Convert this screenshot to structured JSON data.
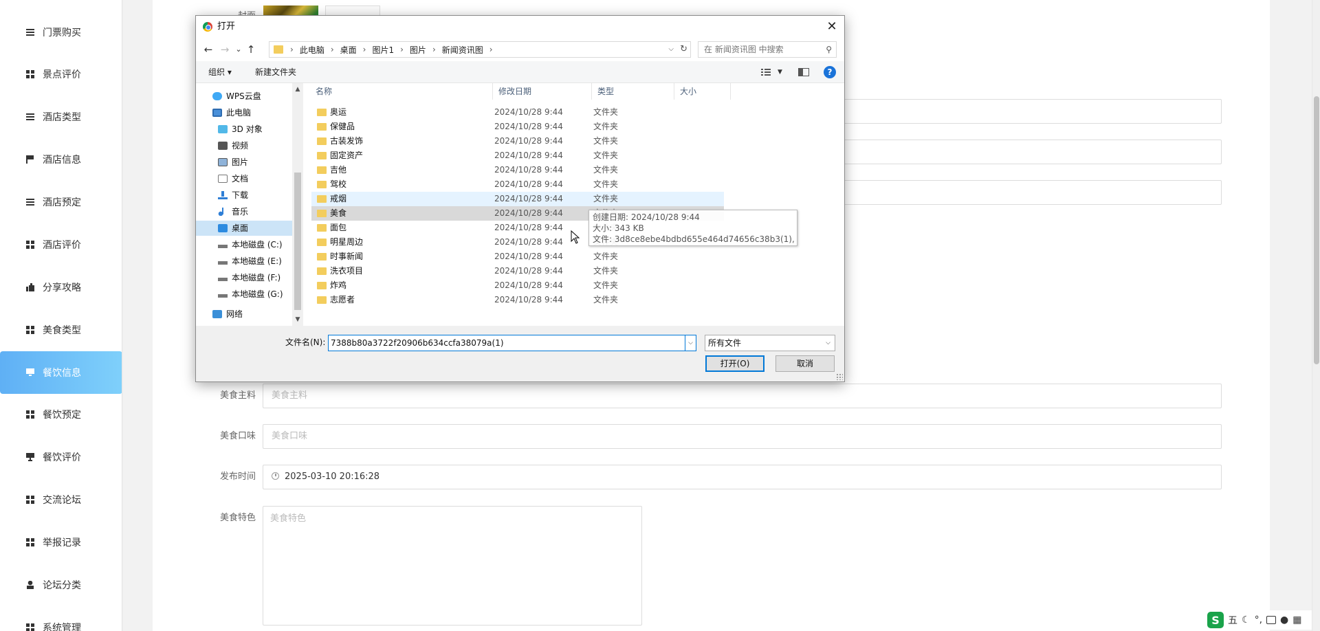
{
  "sidebar": {
    "items": [
      {
        "label": "门票购买",
        "icon": "lines"
      },
      {
        "label": "景点评价",
        "icon": "grid"
      },
      {
        "label": "酒店类型",
        "icon": "lines"
      },
      {
        "label": "酒店信息",
        "icon": "flag"
      },
      {
        "label": "酒店预定",
        "icon": "lines"
      },
      {
        "label": "酒店评价",
        "icon": "grid"
      },
      {
        "label": "分享攻略",
        "icon": "thumb"
      },
      {
        "label": "美食类型",
        "icon": "grid"
      },
      {
        "label": "餐饮信息",
        "icon": "monitor",
        "active": true
      },
      {
        "label": "餐饮预定",
        "icon": "grid"
      },
      {
        "label": "餐饮评价",
        "icon": "cup"
      },
      {
        "label": "交流论坛",
        "icon": "grid"
      },
      {
        "label": "举报记录",
        "icon": "grid"
      },
      {
        "label": "论坛分类",
        "icon": "user"
      },
      {
        "label": "系统管理",
        "icon": "grid"
      }
    ]
  },
  "form": {
    "image_label": "封面",
    "fields": [
      {
        "label": "美食主料",
        "placeholder": "美食主料",
        "value": ""
      },
      {
        "label": "美食口味",
        "placeholder": "美食口味",
        "value": ""
      },
      {
        "label": "发布时间",
        "placeholder": "",
        "value": "2025-03-10 20:16:28"
      }
    ],
    "feature_label": "美食特色",
    "feature_placeholder": "美食特色"
  },
  "dialog": {
    "title": "打开",
    "close_glyph": "✕",
    "nav": {
      "back": "←",
      "forward": "→",
      "recent": "⌄",
      "up": "↑"
    },
    "breadcrumb": [
      "此电脑",
      "桌面",
      "图片1",
      "图片",
      "新闻资讯图"
    ],
    "search_placeholder": "在 新闻资讯图 中搜索",
    "toolbar": {
      "organize": "组织 ▾",
      "new_folder": "新建文件夹",
      "help": "?"
    },
    "nav_pane": [
      {
        "label": "WPS云盘",
        "icon": "cloud",
        "indent": 1
      },
      {
        "label": "此电脑",
        "icon": "pc",
        "indent": 1
      },
      {
        "label": "3D 对象",
        "icon": "cube",
        "indent": 2
      },
      {
        "label": "视频",
        "icon": "video",
        "indent": 2
      },
      {
        "label": "图片",
        "icon": "pic",
        "indent": 2
      },
      {
        "label": "文档",
        "icon": "doc",
        "indent": 2
      },
      {
        "label": "下载",
        "icon": "down",
        "indent": 2
      },
      {
        "label": "音乐",
        "icon": "music",
        "indent": 2
      },
      {
        "label": "桌面",
        "icon": "desk",
        "indent": 2,
        "selected": true
      },
      {
        "label": "本地磁盘 (C:)",
        "icon": "disk",
        "indent": 2
      },
      {
        "label": "本地磁盘 (E:)",
        "icon": "disk",
        "indent": 2
      },
      {
        "label": "本地磁盘 (F:)",
        "icon": "disk",
        "indent": 2
      },
      {
        "label": "本地磁盘 (G:)",
        "icon": "disk",
        "indent": 2
      },
      {
        "label": "网络",
        "icon": "net",
        "indent": 1
      }
    ],
    "columns": {
      "name": "名称",
      "date": "修改日期",
      "type": "类型",
      "size": "大小"
    },
    "files": [
      {
        "name": "奥运",
        "date": "2024/10/28 9:44",
        "type": "文件夹"
      },
      {
        "name": "保健品",
        "date": "2024/10/28 9:44",
        "type": "文件夹"
      },
      {
        "name": "古装发饰",
        "date": "2024/10/28 9:44",
        "type": "文件夹"
      },
      {
        "name": "固定资产",
        "date": "2024/10/28 9:44",
        "type": "文件夹"
      },
      {
        "name": "吉他",
        "date": "2024/10/28 9:44",
        "type": "文件夹"
      },
      {
        "name": "驾校",
        "date": "2024/10/28 9:44",
        "type": "文件夹"
      },
      {
        "name": "戒烟",
        "date": "2024/10/28 9:44",
        "type": "文件夹",
        "state": "hover"
      },
      {
        "name": "美食",
        "date": "2024/10/28 9:44",
        "type": "文件夹",
        "state": "sel"
      },
      {
        "name": "面包",
        "date": "2024/10/28 9:44",
        "type": "文件夹"
      },
      {
        "name": "明星周边",
        "date": "2024/10/28 9:44",
        "type": "文件夹"
      },
      {
        "name": "时事新闻",
        "date": "2024/10/28 9:44",
        "type": "文件夹"
      },
      {
        "name": "洗衣项目",
        "date": "2024/10/28 9:44",
        "type": "文件夹"
      },
      {
        "name": "炸鸡",
        "date": "2024/10/28 9:44",
        "type": "文件夹"
      },
      {
        "name": "志愿者",
        "date": "2024/10/28 9:44",
        "type": "文件夹"
      }
    ],
    "tooltip": {
      "created": "创建日期: 2024/10/28 9:44",
      "size": "大小: 343 KB",
      "files": "文件: 3d8ce8ebe4bdbd655e464d74656c38b3(1), ..."
    },
    "filename_label": "文件名(N):",
    "filename_value": "7388b80a3722f20906b634ccfa38079a(1)",
    "filetype_value": "所有文件",
    "open_button": "打开(O)",
    "cancel_button": "取消"
  },
  "tray": {
    "ime": "五",
    "logo": "S"
  }
}
